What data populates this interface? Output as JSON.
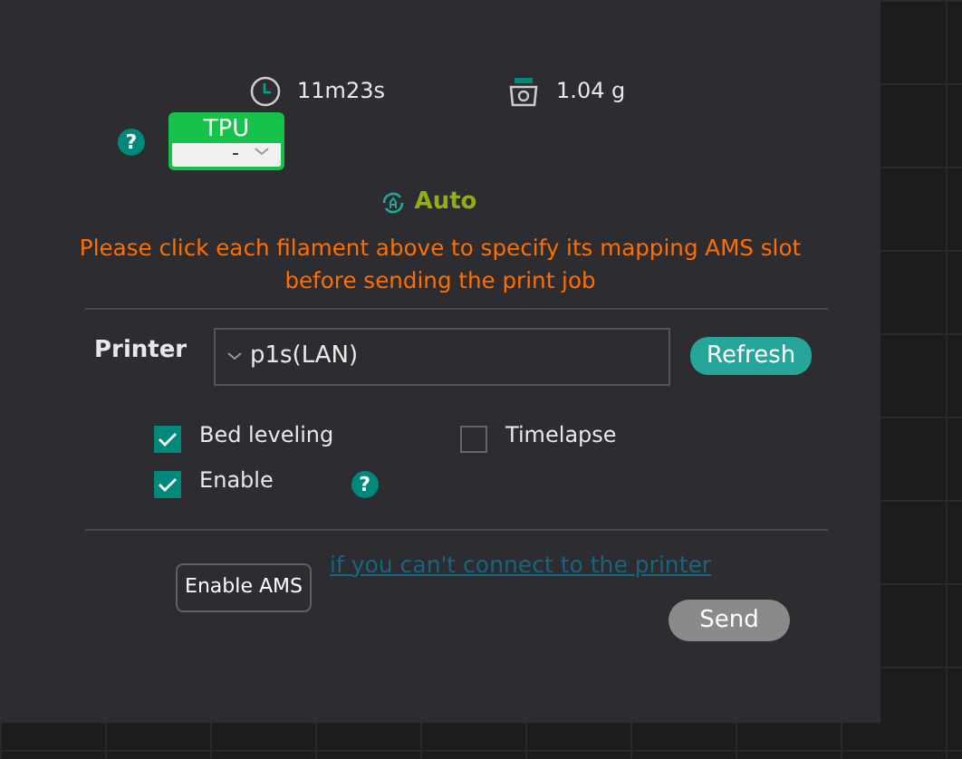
{
  "stats": [
    {
      "kind": "time",
      "value": "11m23s"
    },
    {
      "kind": "weight",
      "value": "1.04 g"
    }
  ],
  "filament_help": "?",
  "filaments": [
    {
      "name": "TPU",
      "color": "#17c24a",
      "slot": "-"
    }
  ],
  "mapping_mode": "Auto",
  "warning": "Please click each filament above to specify its mapping AMS slot before sending the print job",
  "printer": {
    "label": "Printer",
    "value": "p1s(LAN)",
    "refresh_button": "Refresh"
  },
  "options": [
    {
      "label": "Bed leveling",
      "checked": true
    },
    {
      "label": "Timelapse",
      "checked": false
    },
    {
      "label": "Enable",
      "checked": true,
      "help": "?"
    }
  ],
  "link": "if you can't connect to the printer",
  "tooltip": "Enable AMS",
  "send_button": "Send"
}
